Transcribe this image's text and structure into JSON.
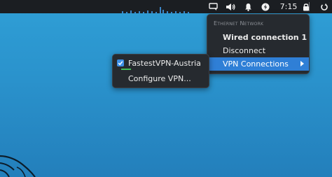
{
  "panel": {
    "clock": "7:15",
    "icons": [
      "screen-icon",
      "volume-icon",
      "bell-icon",
      "network-icon",
      "lock-icon",
      "power-icon"
    ]
  },
  "network_menu": {
    "heading": "Ethernet Network",
    "items": [
      {
        "label": "Wired connection 1",
        "bold": true
      },
      {
        "label": "Disconnect"
      },
      {
        "label": "VPN Connections",
        "highlighted": true,
        "submenu": true
      }
    ]
  },
  "vpn_menu": {
    "items": [
      {
        "label": "FastestVPN-Austria",
        "checked": true
      },
      {
        "label": "Configure VPN..."
      }
    ]
  },
  "colors": {
    "desktop": "#2a92cc",
    "panel": "#1b1e22",
    "menu": "#262a2f",
    "highlight": "#2f7fd6",
    "active_vpn": "#43c05a"
  }
}
